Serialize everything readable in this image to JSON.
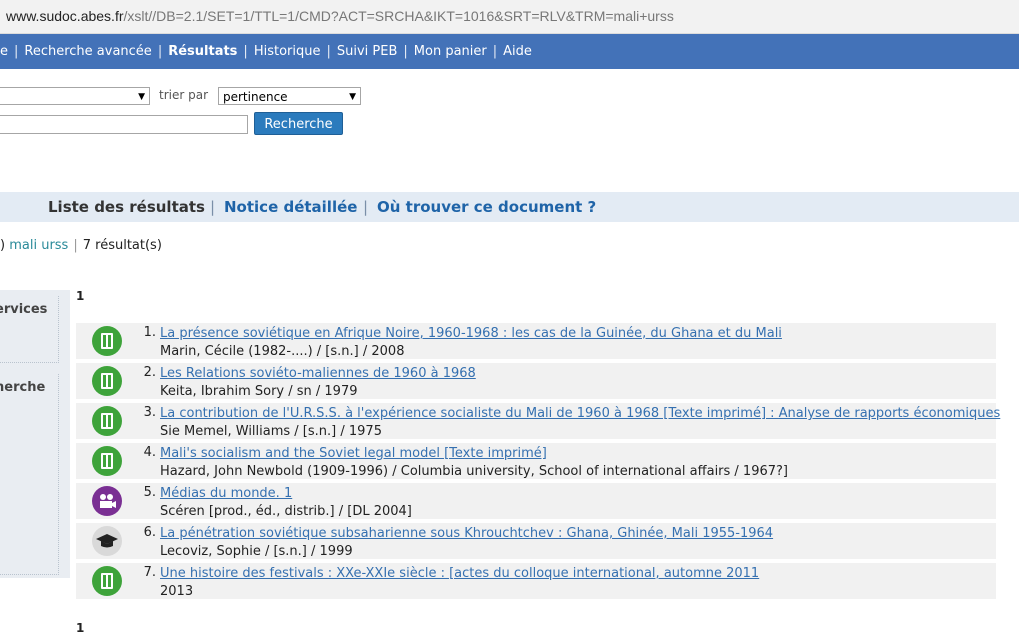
{
  "browser": {
    "url_domain": "www.sudoc.abes.fr",
    "url_path": "/xslt//DB=2.1/SET=1/TTL=1/CMD?ACT=SRCHA&IKT=1016&SRT=RLV&TRM=mali+urss"
  },
  "nav": {
    "items": [
      {
        "label": "e",
        "active": false
      },
      {
        "label": "Recherche avancée",
        "active": false
      },
      {
        "label": "Résultats",
        "active": true
      },
      {
        "label": "Historique",
        "active": false
      },
      {
        "label": "Suivi PEB",
        "active": false
      },
      {
        "label": "Mon panier",
        "active": false
      },
      {
        "label": "Aide",
        "active": false
      }
    ]
  },
  "search": {
    "sort_label": "trier par",
    "sort_value": "pertinence",
    "button_label": "Recherche"
  },
  "tabs": {
    "list": "Liste des résultats",
    "detail": "Notice détaillée",
    "where": "Où trouver ce document ?"
  },
  "query": {
    "paren": ")",
    "terms": "mali urss",
    "count": "7 résultat(s)"
  },
  "side": {
    "panel1": "ervices",
    "panel2": "herche"
  },
  "pages": {
    "top": "1",
    "bottom": "1"
  },
  "results": [
    {
      "num": "1.",
      "type": "book-icon",
      "color": "#3ea33a",
      "title": "La présence soviétique en Afrique Noire, 1960-1968 : les cas de la Guinée, du Ghana et du Mali",
      "authors": "Marin, Cécile (1982-....) / [s.n.] / 2008"
    },
    {
      "num": "2.",
      "type": "book-icon",
      "color": "#3ea33a",
      "title": "Les Relations soviéto-maliennes de 1960 à 1968",
      "authors": "Keita, Ibrahim Sory / sn / 1979"
    },
    {
      "num": "3.",
      "type": "book-icon",
      "color": "#3ea33a",
      "title": "La contribution de l'U.R.S.S. à l'expérience socialiste du Mali de 1960 à 1968 [Texte imprimé] : Analyse de rapports économiques",
      "authors": "Sie Memel, Williams / [s.n.] / 1975"
    },
    {
      "num": "4.",
      "type": "book-icon",
      "color": "#3ea33a",
      "title": "Mali's socialism and the Soviet legal model [Texte imprimé]",
      "authors": "Hazard, John Newbold (1909-1996) / Columbia university, School of international affairs / 1967?]"
    },
    {
      "num": "5.",
      "type": "video-icon",
      "color": "#7a2f93",
      "title": "Médias du monde. 1",
      "authors": "Scéren [prod., éd., distrib.] / [DL 2004]"
    },
    {
      "num": "6.",
      "type": "thesis-icon",
      "color": "#d9d9d9",
      "title": "La pénétration soviétique subsaharienne sous Khrouchtchev : Ghana, Ghinée, Mali 1955-1964",
      "authors": "Lecoviz, Sophie / [s.n.] / 1999"
    },
    {
      "num": "7.",
      "type": "book-icon",
      "color": "#3ea33a",
      "title": "Une histoire des festivals : XXe-XXIe siècle : [actes du colloque international, automne 2011",
      "authors": "2013"
    }
  ]
}
